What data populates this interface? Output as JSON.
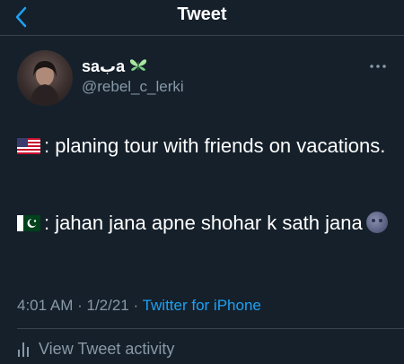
{
  "header": {
    "title": "Tweet"
  },
  "author": {
    "name": "saبa",
    "handle": "@rebel_c_lerki"
  },
  "tweet": {
    "line1": ": planing tour with friends on vacations.",
    "line2": ": jahan jana apne shohar k sath jana"
  },
  "meta": {
    "time": "4:01 AM",
    "date": "1/2/21",
    "source": "Twitter for iPhone"
  },
  "activity": {
    "label": "View Tweet activity"
  },
  "colors": {
    "background": "#15202b",
    "accent": "#1da1f2",
    "muted": "#8899a6"
  },
  "icons": [
    "back-chevron-icon",
    "butterfly-icon",
    "more-options-icon",
    "us-flag-icon",
    "pakistan-flag-icon",
    "moon-face-icon",
    "bar-chart-icon"
  ]
}
